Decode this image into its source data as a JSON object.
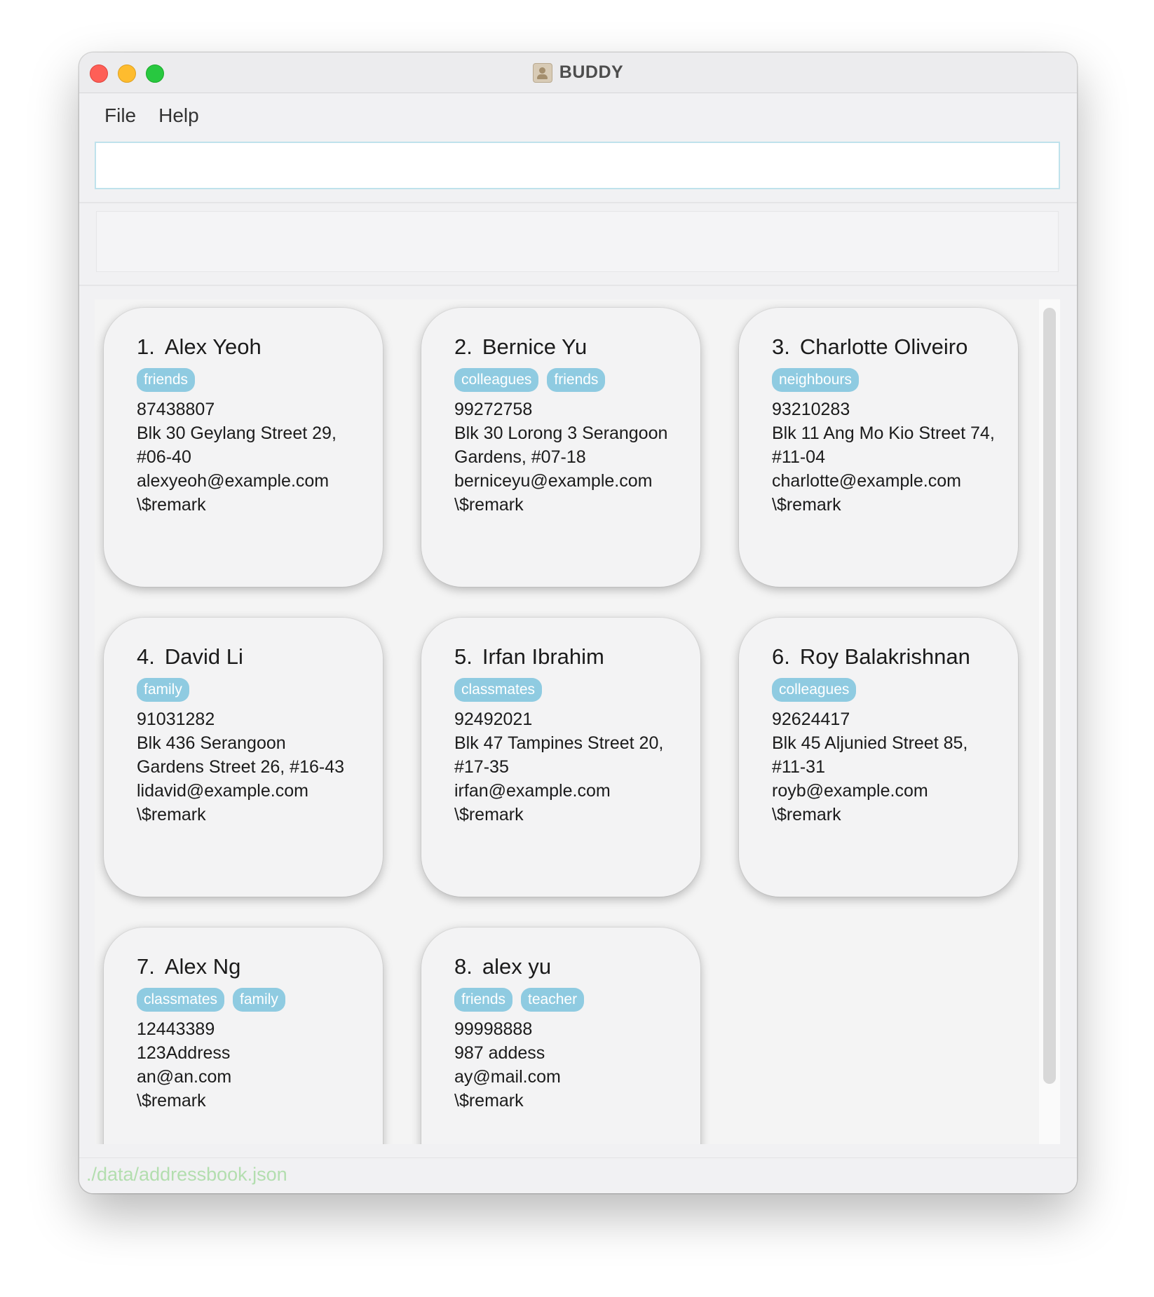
{
  "window": {
    "title": "BUDDY"
  },
  "menu": {
    "file": "File",
    "help": "Help"
  },
  "command_box": {
    "value": ""
  },
  "result_box": {
    "text": ""
  },
  "persons": [
    {
      "index": "1.",
      "name": "Alex Yeoh",
      "tags": [
        "friends"
      ],
      "phone": "87438807",
      "address_lines": [
        "Blk 30 Geylang Street 29,",
        "#06-40"
      ],
      "email": "alexyeoh@example.com",
      "remark": "\\$remark"
    },
    {
      "index": "2.",
      "name": "Bernice Yu",
      "tags": [
        "colleagues",
        "friends"
      ],
      "phone": "99272758",
      "address_lines": [
        "Blk 30 Lorong 3 Serangoon",
        "Gardens, #07-18"
      ],
      "email": "berniceyu@example.com",
      "remark": "\\$remark"
    },
    {
      "index": "3.",
      "name": "Charlotte Oliveiro",
      "tags": [
        "neighbours"
      ],
      "phone": "93210283",
      "address_lines": [
        "Blk 11 Ang Mo Kio Street 74,",
        "#11-04"
      ],
      "email": "charlotte@example.com",
      "remark": "\\$remark"
    },
    {
      "index": "4.",
      "name": "David Li",
      "tags": [
        "family"
      ],
      "phone": "91031282",
      "address_lines": [
        "Blk 436 Serangoon",
        "Gardens Street 26, #16-43"
      ],
      "email": "lidavid@example.com",
      "remark": "\\$remark"
    },
    {
      "index": "5.",
      "name": "Irfan Ibrahim",
      "tags": [
        "classmates"
      ],
      "phone": "92492021",
      "address_lines": [
        "Blk 47 Tampines Street 20,",
        "#17-35"
      ],
      "email": "irfan@example.com",
      "remark": "\\$remark"
    },
    {
      "index": "6.",
      "name": "Roy Balakrishnan",
      "tags": [
        "colleagues"
      ],
      "phone": "92624417",
      "address_lines": [
        "Blk 45 Aljunied Street 85,",
        "#11-31"
      ],
      "email": "royb@example.com",
      "remark": "\\$remark"
    },
    {
      "index": "7.",
      "name": "Alex Ng",
      "tags": [
        "classmates",
        "family"
      ],
      "phone": "12443389",
      "address_lines": [
        "123Address"
      ],
      "email": "an@an.com",
      "remark": "\\$remark"
    },
    {
      "index": "8.",
      "name": "alex yu",
      "tags": [
        "friends",
        "teacher"
      ],
      "phone": "99998888",
      "address_lines": [
        "987 addess"
      ],
      "email": "ay@mail.com",
      "remark": "\\$remark"
    }
  ],
  "status_bar": {
    "path": "./data/addressbook.json"
  },
  "colors": {
    "tag_bg": "#8fcbe1",
    "tag_text": "#ffffff",
    "status_text": "#b3deaf"
  },
  "icons": {
    "app": "contact-book-icon"
  }
}
